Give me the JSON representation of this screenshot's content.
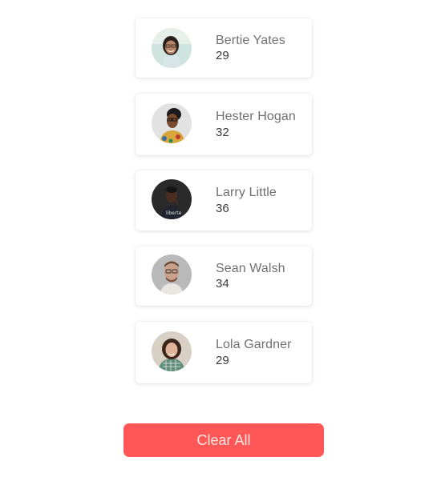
{
  "people": [
    {
      "name": "Bertie Yates",
      "age": "29"
    },
    {
      "name": "Hester Hogan",
      "age": "32"
    },
    {
      "name": "Larry Little",
      "age": "36"
    },
    {
      "name": "Sean Walsh",
      "age": "34"
    },
    {
      "name": "Lola Gardner",
      "age": "29"
    }
  ],
  "actions": {
    "clear_all_label": "Clear All"
  },
  "colors": {
    "button_bg": "#ff5657",
    "name_text": "#707070",
    "age_text": "#3a3a3a"
  }
}
